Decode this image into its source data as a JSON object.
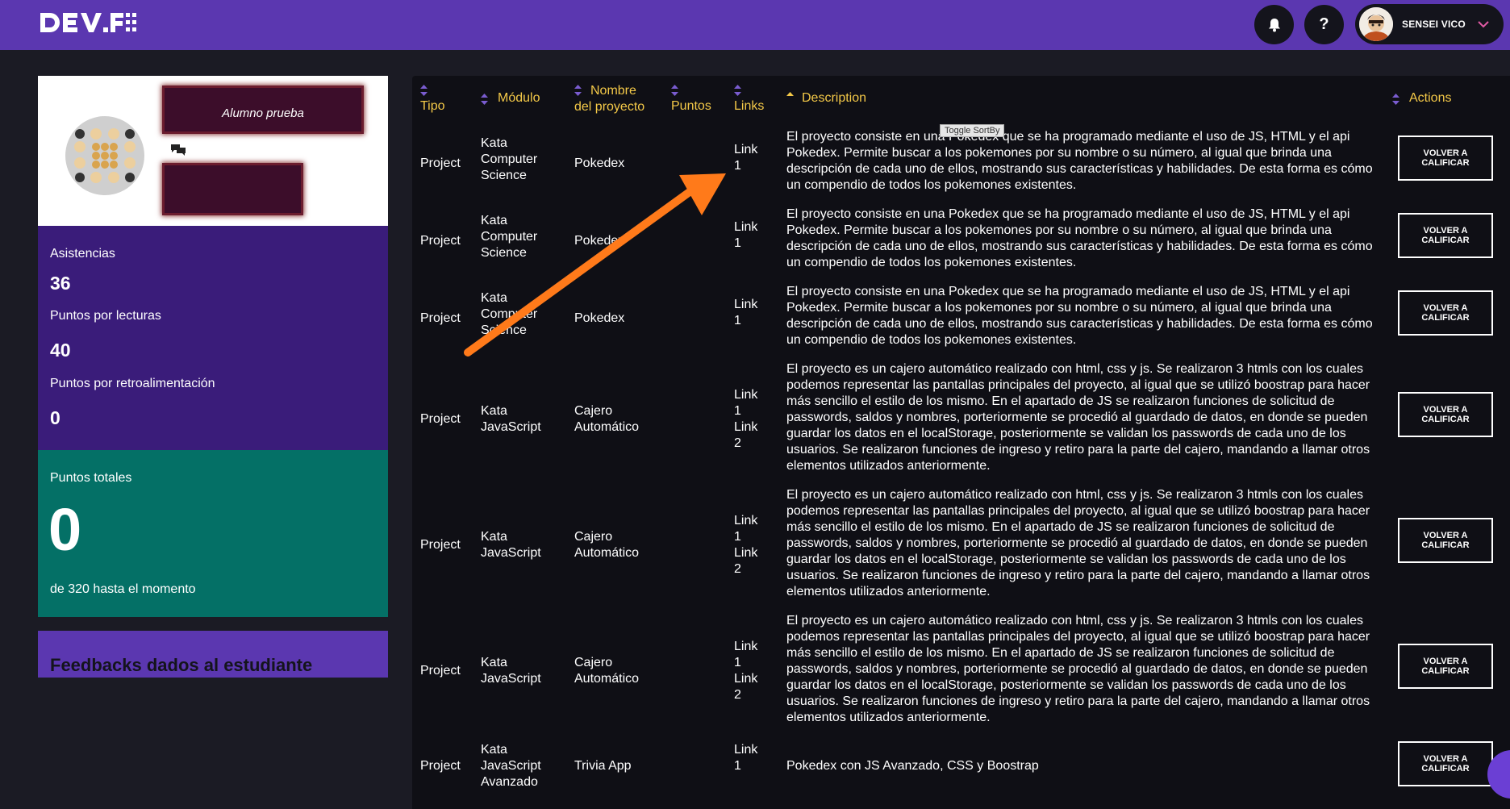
{
  "header": {
    "logo_text": "DEV.F.",
    "notifications_icon": "bell-icon",
    "help_label": "?",
    "user_name": "SENSEI VICO",
    "user_menu_icon": "chevron-down-icon"
  },
  "profile": {
    "student_name": "Alumno prueba",
    "message_icon": "chat-bubbles-icon"
  },
  "stats": {
    "attendance_label": "Asistencias",
    "attendance_value": "36",
    "reading_label": "Puntos por lecturas",
    "reading_value": "40",
    "feedback_points_label": "Puntos por retroalimentación",
    "feedback_points_value": "0"
  },
  "totals": {
    "label": "Puntos totales",
    "value": "0",
    "sub": "de 320 hasta el momento"
  },
  "feedback": {
    "title": "Feedbacks dados al estudiante"
  },
  "table": {
    "tooltip": "Toggle SortBy",
    "headers": {
      "tipo": "Tipo",
      "modulo": "Módulo",
      "nombre": "Nombre del proyecto",
      "puntos": "Puntos",
      "links": "Links",
      "description": "Description",
      "actions": "Actions"
    },
    "rows": [
      {
        "tipo": "Project",
        "modulo": "Kata Computer Science",
        "nombre": "Pokedex",
        "puntos": "",
        "link1": "Link 1",
        "link2": "",
        "description": "El proyecto consiste en una Pokedex que se ha programado mediante el uso de JS, HTML y el api Pokedex. Permite buscar a los pokemones por su nombre o su número, al igual que brinda una descripción de cada uno de ellos, mostrando sus características y habilidades. De esta forma es cómo un compendio de todos los pokemones existentes.",
        "action": "VOLVER A CALIFICAR"
      },
      {
        "tipo": "Project",
        "modulo": "Kata Computer Science",
        "nombre": "Pokedex",
        "puntos": "",
        "link1": "Link 1",
        "link2": "",
        "description": "El proyecto consiste en una Pokedex que se ha programado mediante el uso de JS, HTML y el api Pokedex. Permite buscar a los pokemones por su nombre o su número, al igual que brinda una descripción de cada uno de ellos, mostrando sus características y habilidades. De esta forma es cómo un compendio de todos los pokemones existentes.",
        "action": "VOLVER A CALIFICAR"
      },
      {
        "tipo": "Project",
        "modulo": "Kata Computer Science",
        "nombre": "Pokedex",
        "puntos": "",
        "link1": "Link 1",
        "link2": "",
        "description": "El proyecto consiste en una Pokedex que se ha programado mediante el uso de JS, HTML y el api Pokedex. Permite buscar a los pokemones por su nombre o su número, al igual que brinda una descripción de cada uno de ellos, mostrando sus características y habilidades. De esta forma es cómo un compendio de todos los pokemones existentes.",
        "action": "VOLVER A CALIFICAR"
      },
      {
        "tipo": "Project",
        "modulo": "Kata JavaScript",
        "nombre": "Cajero Automático",
        "puntos": "",
        "link1": "Link 1",
        "link2": "Link 2",
        "description": "El proyecto es un cajero automático realizado con html, css y js. Se realizaron 3 htmls con los cuales podemos representar las pantallas principales del proyecto, al igual que se utilizó boostrap para hacer más sencillo el estilo de los mismo. En el apartado de JS se realizaron funciones de solicitud de passwords, saldos y nombres, porteriormente se procedió al guardado de datos, en donde se pueden guardar los datos en el localStorage, posteriormente se validan los passwords de cada uno de los usuarios. Se realizaron funciones de ingreso y retiro para la parte del cajero, mandando a llamar otros elementos utilizados anteriormente.",
        "action": "VOLVER A CALIFICAR"
      },
      {
        "tipo": "Project",
        "modulo": "Kata JavaScript",
        "nombre": "Cajero Automático",
        "puntos": "",
        "link1": "Link 1",
        "link2": "Link 2",
        "description": "El proyecto es un cajero automático realizado con html, css y js. Se realizaron 3 htmls con los cuales podemos representar las pantallas principales del proyecto, al igual que se utilizó boostrap para hacer más sencillo el estilo de los mismo. En el apartado de JS se realizaron funciones de solicitud de passwords, saldos y nombres, porteriormente se procedió al guardado de datos, en donde se pueden guardar los datos en el localStorage, posteriormente se validan los passwords de cada uno de los usuarios. Se realizaron funciones de ingreso y retiro para la parte del cajero, mandando a llamar otros elementos utilizados anteriormente.",
        "action": "VOLVER A CALIFICAR"
      },
      {
        "tipo": "Project",
        "modulo": "Kata JavaScript",
        "nombre": "Cajero Automático",
        "puntos": "",
        "link1": "Link 1",
        "link2": "Link 2",
        "description": "El proyecto es un cajero automático realizado con html, css y js. Se realizaron 3 htmls con los cuales podemos representar las pantallas principales del proyecto, al igual que se utilizó boostrap para hacer más sencillo el estilo de los mismo. En el apartado de JS se realizaron funciones de solicitud de passwords, saldos y nombres, porteriormente se procedió al guardado de datos, en donde se pueden guardar los datos en el localStorage, posteriormente se validan los passwords de cada uno de los usuarios. Se realizaron funciones de ingreso y retiro para la parte del cajero, mandando a llamar otros elementos utilizados anteriormente.",
        "action": "VOLVER A CALIFICAR"
      },
      {
        "tipo": "Project",
        "modulo": "Kata JavaScript Avanzado",
        "nombre": "Trivia App",
        "puntos": "",
        "link1": "Link 1",
        "link2": "",
        "description": "Pokedex con JS Avanzado, CSS y Boostrap",
        "action": "VOLVER A CALIFICAR"
      }
    ]
  },
  "colors": {
    "header_bg": "#5b37b0",
    "page_bg": "#1b1b24",
    "stats_bg": "#3a1c7a",
    "total_bg": "#047066",
    "header_text_accent": "#f4c948",
    "annotation_arrow": "#ff7a1a"
  }
}
